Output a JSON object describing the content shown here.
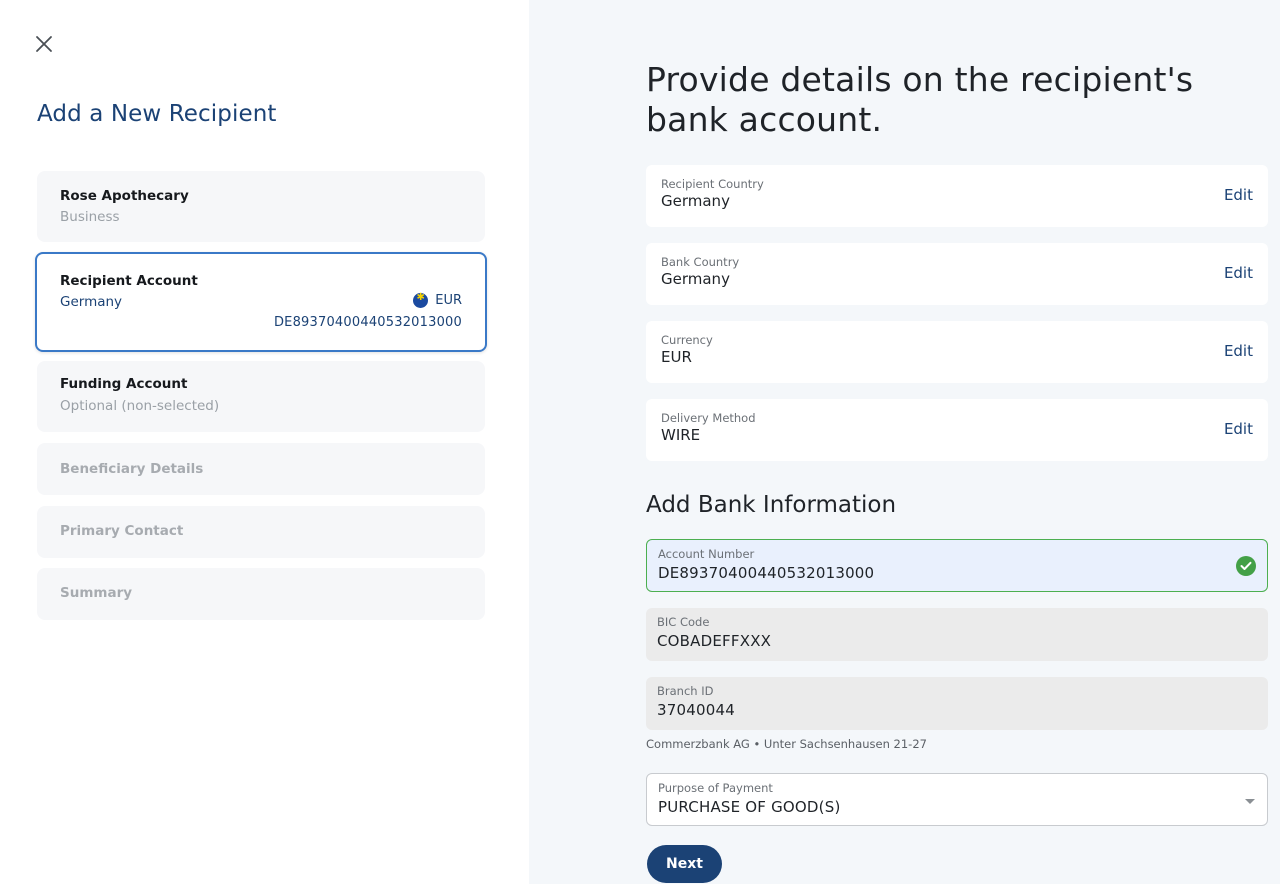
{
  "sidebar": {
    "title": "Add a New Recipient",
    "steps": [
      {
        "name": "Rose Apothecary",
        "sub": "Business"
      },
      {
        "name": "Recipient Account",
        "sub": "Germany",
        "currency": "EUR",
        "iban": "DE89370400440532013000"
      },
      {
        "name": "Funding Account",
        "sub": "Optional (non-selected)"
      },
      {
        "name": "Beneficiary Details"
      },
      {
        "name": "Primary Contact"
      },
      {
        "name": "Summary"
      }
    ]
  },
  "main": {
    "heading": "Provide details on the recipient's bank account.",
    "info": [
      {
        "label": "Recipient Country",
        "value": "Germany",
        "action": "Edit"
      },
      {
        "label": "Bank Country",
        "value": "Germany",
        "action": "Edit"
      },
      {
        "label": "Currency",
        "value": "EUR",
        "action": "Edit"
      },
      {
        "label": "Delivery Method",
        "value": "WIRE",
        "action": "Edit"
      }
    ],
    "bank_section_title": "Add Bank Information",
    "account_number": {
      "label": "Account Number",
      "value": "DE89370400440532013000"
    },
    "bic_code": {
      "label": "BIC Code",
      "value": "COBADEFFXXX"
    },
    "branch_id": {
      "label": "Branch ID",
      "value": "37040044"
    },
    "bank_note": "Commerzbank AG • Unter Sachsenhausen 21-27",
    "purpose": {
      "label": "Purpose of Payment",
      "value": "PURCHASE OF GOOD(S)"
    },
    "next_label": "Next"
  },
  "colors": {
    "accent": "#1b4275",
    "active_border": "#3a79c7",
    "success": "#43a047"
  },
  "icons": {
    "close": "close-icon",
    "flag": "eu-flag-icon",
    "check": "check-circle-icon",
    "caret": "chevron-down-icon"
  }
}
